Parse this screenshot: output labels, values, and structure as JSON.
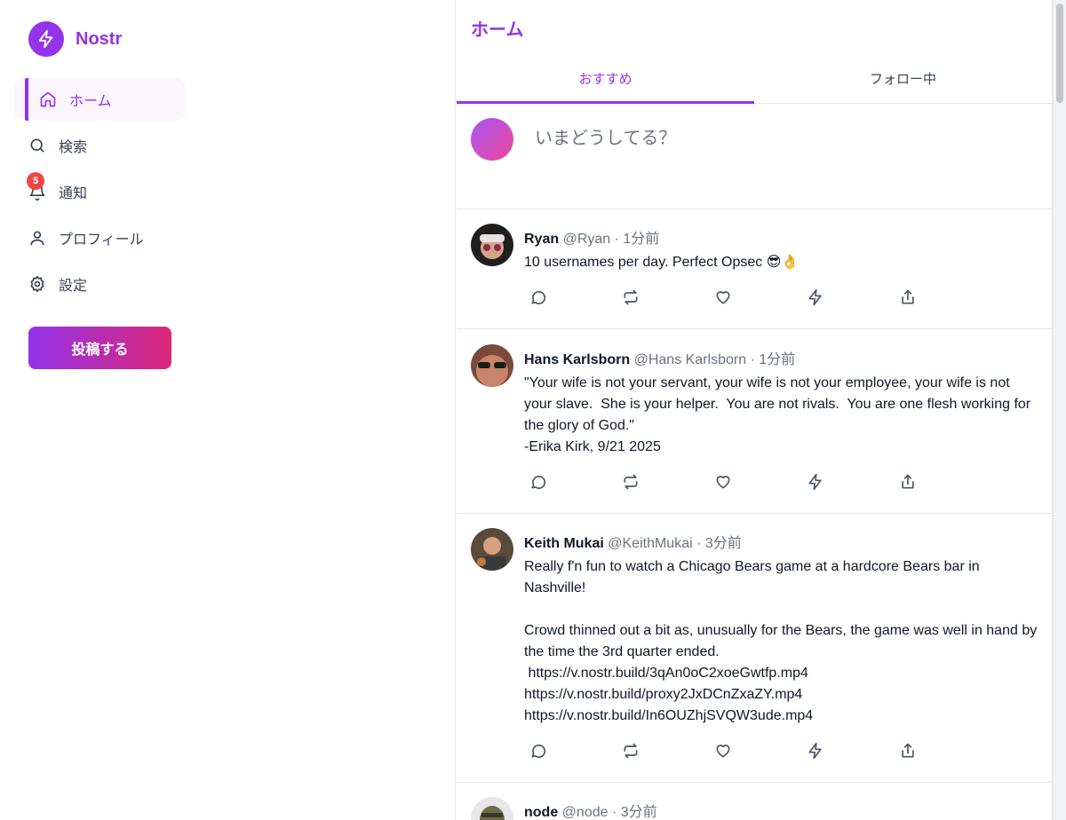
{
  "app": {
    "name": "Nostr"
  },
  "sidebar": {
    "items": [
      {
        "label": "ホーム",
        "icon": "home-icon",
        "active": true
      },
      {
        "label": "検索",
        "icon": "search-icon",
        "active": false
      },
      {
        "label": "通知",
        "icon": "bell-icon",
        "active": false,
        "badge": "5"
      },
      {
        "label": "プロフィール",
        "icon": "user-icon",
        "active": false
      },
      {
        "label": "設定",
        "icon": "gear-icon",
        "active": false
      }
    ],
    "post_button": "投稿する"
  },
  "main": {
    "title": "ホーム",
    "tabs": [
      {
        "label": "おすすめ",
        "active": true
      },
      {
        "label": "フォロー中",
        "active": false
      }
    ],
    "composer": {
      "placeholder": "いまどうしてる？"
    }
  },
  "posts": [
    {
      "name": "Ryan",
      "handle": "@Ryan",
      "time": "1分前",
      "body": "10 usernames per day. Perfect Opsec 😎👌"
    },
    {
      "name": "Hans Karlsborn",
      "handle": "@Hans Karlsborn",
      "time": "1分前",
      "body": "\"Your wife is not your servant, your wife is not your employee, your wife is not your slave.  She is your helper.  You are not rivals.  You are one flesh working for the glory of God.\"\n-Erika Kirk, 9/21 2025"
    },
    {
      "name": "Keith Mukai",
      "handle": "@KeithMukai",
      "time": "3分前",
      "body": "Really f'n fun to watch a Chicago Bears game at a hardcore Bears bar in Nashville!\n\nCrowd thinned out a bit as, unusually for the Bears, the game was well in hand by the time the 3rd quarter ended.\n https://v.nostr.build/3qAn0oC2xoeGwtfp.mp4\nhttps://v.nostr.build/proxy2JxDCnZxaZY.mp4\nhttps://v.nostr.build/In6OUZhjSVQW3ude.mp4"
    },
    {
      "name": "node",
      "handle": "@node",
      "time": "3分前",
      "body": ""
    }
  ],
  "colors": {
    "accent": "#9333ea",
    "accent2": "#db2777",
    "badge": "#ef4444"
  }
}
